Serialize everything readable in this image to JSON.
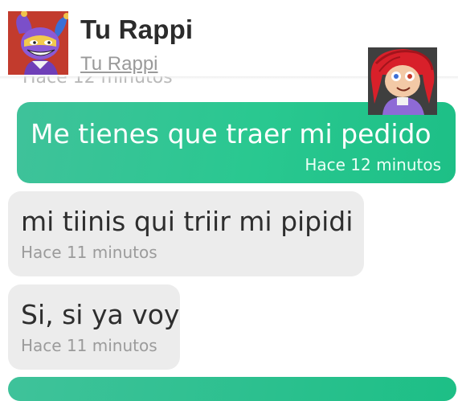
{
  "header": {
    "contact_name": "Tu Rappi",
    "contact_subtitle": "Tu Rappi",
    "behind_header_text": "Hace 12 minutos"
  },
  "messages": [
    {
      "direction": "outgoing",
      "text": "Me tienes que traer mi pedido",
      "time": "Hace 12 minutos"
    },
    {
      "direction": "incoming",
      "text": "mi tiinis qui triir mi pipidi",
      "time": "Hace 11 minutos"
    },
    {
      "direction": "incoming",
      "text": "Si, si ya voy",
      "time": "Hace 11 minutos"
    }
  ],
  "colors": {
    "outgoing_bubble": "#29c890",
    "incoming_bubble": "#ececec",
    "header_text": "#2b2b2b",
    "muted_text": "#9b9b9b"
  },
  "icons": {
    "header_avatar": "jester-character-avatar-icon",
    "sticker": "red-haired-doll-character-sticker"
  }
}
